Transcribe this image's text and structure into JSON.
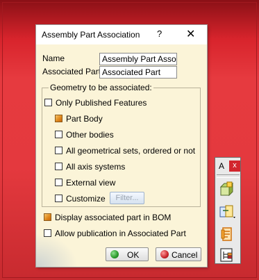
{
  "dialog": {
    "title": "Assembly Part Association",
    "help_label": "?",
    "close_label": "✕",
    "name_label": "Name",
    "name_value": "Assembly Part Assoc",
    "associated_part_label": "Associated Part",
    "associated_part_value": "Associated Part",
    "group_title": "Geometry to be associated:",
    "options": {
      "only_published": {
        "label": "Only Published Features",
        "checked": false
      },
      "part_body": {
        "label": "Part Body",
        "checked": true
      },
      "other_bodies": {
        "label": "Other bodies",
        "checked": false
      },
      "all_geom_sets": {
        "label": "All geometrical sets, ordered or not",
        "checked": false
      },
      "all_axis": {
        "label": "All axis systems",
        "checked": false
      },
      "external_view": {
        "label": "External view",
        "checked": false
      },
      "customize": {
        "label": "Customize",
        "checked": false
      }
    },
    "filter_label": "Filter...",
    "display_bom": {
      "label": "Display associated part in BOM",
      "checked": true
    },
    "allow_pub": {
      "label": "Allow publication in Associated Part",
      "checked": false
    },
    "ok_label": "OK",
    "cancel_label": "Cancel"
  },
  "toolbar": {
    "title": "A",
    "close_label": "x",
    "icons": [
      "assembly-component-icon",
      "part-association-icon",
      "orange-document-icon",
      "tree-structure-icon"
    ]
  },
  "colors": {
    "background": "#e4393e",
    "dialog_bg": "#fbf4d8",
    "checked_orange": "#e08a1e",
    "ok_green": "#2a9a2a",
    "cancel_red": "#c8242a"
  }
}
